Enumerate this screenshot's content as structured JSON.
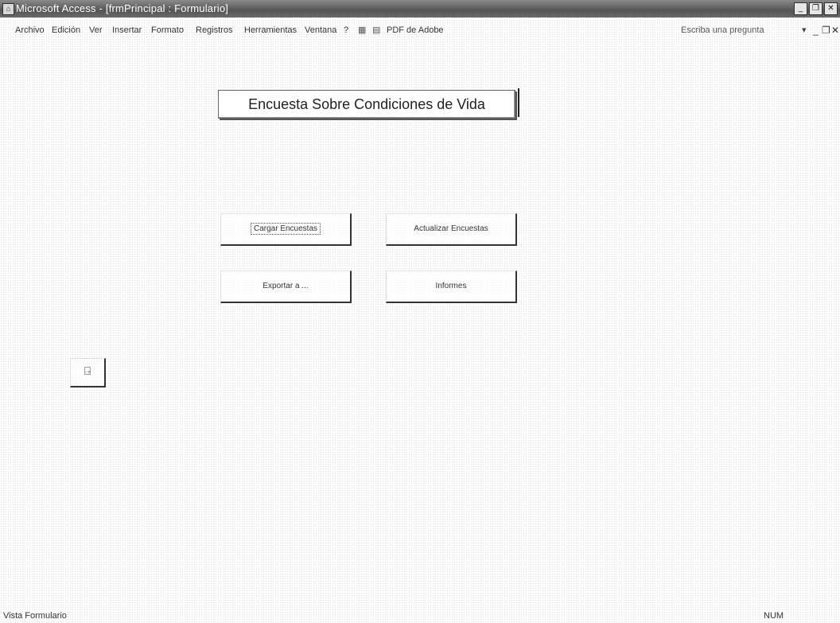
{
  "window": {
    "title": "Microsoft Access - [frmPrincipal : Formulario]",
    "controls": {
      "minimize": "_",
      "restore": "❐",
      "close": "✕"
    }
  },
  "menubar": {
    "items": [
      "Archivo",
      "Edición",
      "Ver",
      "Insertar",
      "Formato",
      "Registros",
      "Herramientas",
      "Ventana",
      "?",
      "PDF de Adobe"
    ],
    "help_placeholder": "Escriba una pregunta",
    "help_arrow": "▾",
    "mdi_controls": {
      "minimize": "_",
      "restore": "❐",
      "close": "✕"
    }
  },
  "form": {
    "title": "Encuesta Sobre Condiciones de Vida",
    "buttons": {
      "cargar": "Cargar Encuestas",
      "actualizar": "Actualizar Encuestas",
      "exportar": "Exportar a ...",
      "informes": "Informes"
    },
    "exit_icon": "exit-door-icon"
  },
  "statusbar": {
    "left": "Vista Formulario",
    "right": "NUM"
  }
}
